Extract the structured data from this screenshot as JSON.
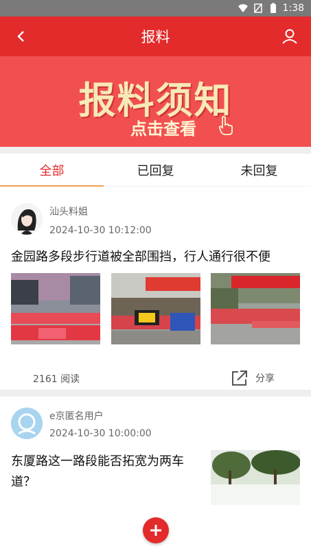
{
  "status_bar": {
    "time": "1:38",
    "icons": [
      "wifi-icon",
      "sim-icon",
      "battery-icon"
    ]
  },
  "header": {
    "title": "报料",
    "back_icon": "chevron-left-icon",
    "user_icon": "user-icon"
  },
  "banner": {
    "title": "报料须知",
    "subtitle": "点击查看",
    "hand_icon": "pointing-hand-icon"
  },
  "tabs": [
    {
      "label": "全部",
      "active": true
    },
    {
      "label": "已回复",
      "active": false
    },
    {
      "label": "未回复",
      "active": false
    }
  ],
  "posts": [
    {
      "author": "汕头料姐",
      "time": "2024-10-30 10:12:00",
      "title": "金园路多段步行道被全部围挡，行人通行很不便",
      "reads": "2161 阅读",
      "share_label": "分享",
      "images": [
        "street-photo-1",
        "street-photo-2",
        "street-photo-3"
      ]
    },
    {
      "author": "e京匿名用户",
      "time": "2024-10-30 10:00:00",
      "title_lines": [
        "东厦路这一路段能否拓宽为两车",
        "道？"
      ],
      "images": [
        "street-photo-4"
      ]
    }
  ],
  "fab": {
    "icon": "plus-icon"
  },
  "colors": {
    "primary": "#e32b2b",
    "banner": "#f25050",
    "tab_underline": "#f0a050"
  }
}
